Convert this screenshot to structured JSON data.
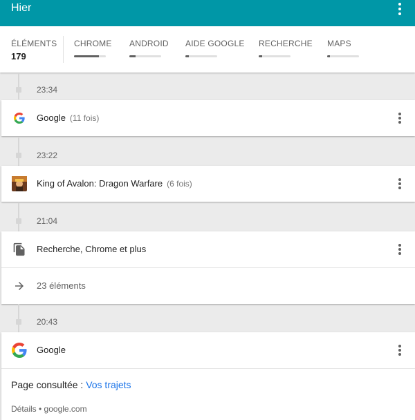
{
  "header": {
    "title": "Hier"
  },
  "stats": {
    "total_label": "ÉLÉMENTS",
    "total_value": "179",
    "categories": [
      {
        "label": "CHROME",
        "fill_fraction": 0.78
      },
      {
        "label": "ANDROID",
        "fill_fraction": 0.2
      },
      {
        "label": "AIDE GOOGLE",
        "fill_fraction": 0.1
      },
      {
        "label": "RECHERCHE",
        "fill_fraction": 0.1
      },
      {
        "label": "MAPS",
        "fill_fraction": 0.08
      }
    ]
  },
  "entries": [
    {
      "time": "23:34",
      "title": "Google",
      "count": "(11 fois)",
      "icon": "google-g-icon"
    },
    {
      "time": "23:22",
      "title": "King of Avalon: Dragon Warfare",
      "count": "(6 fois)",
      "icon": "app-icon"
    },
    {
      "time": "21:04",
      "title": "Recherche, Chrome et plus",
      "icon": "document-icon",
      "sub_label": "23 éléments",
      "sub_icon": "arrow-right-icon"
    },
    {
      "time": "20:43",
      "title": "Google",
      "icon": "google-g-icon",
      "page_prefix": "Page consultée : ",
      "page_link": "Vos trajets",
      "details": "Détails • google.com"
    }
  ],
  "colors": {
    "header": "#0097a7",
    "link": "#1a73e8",
    "background": "#ebebeb"
  }
}
